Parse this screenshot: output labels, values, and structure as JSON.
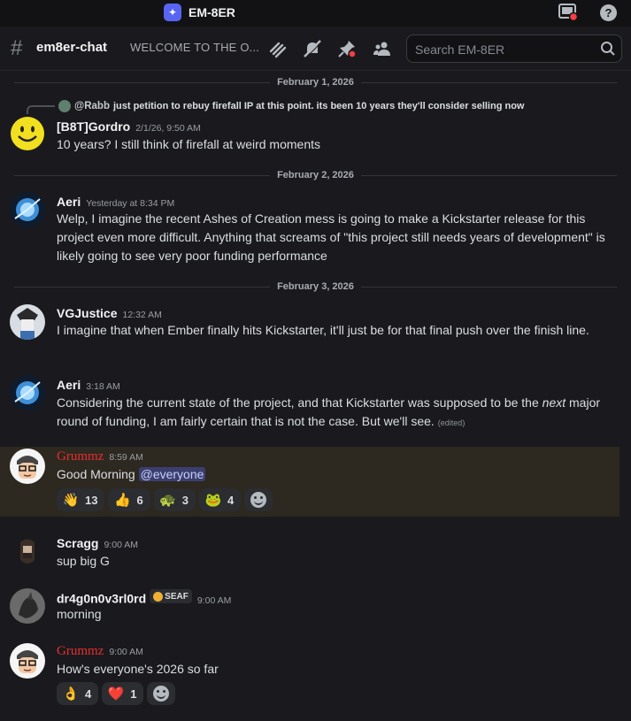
{
  "app": {
    "name": "EM-8ER",
    "icon": "discord-app-icon"
  },
  "channel": {
    "name": "em8er-chat",
    "topic": "WELCOME TO THE O..."
  },
  "search": {
    "placeholder": "Search EM-8ER"
  },
  "colors": {
    "background": "#1a1a1e",
    "username_red": "#e62e2e",
    "mention_bg": "#3b3f6e",
    "highlight": "#2d2820"
  },
  "dividers": [
    "February 1, 2026",
    "February 2, 2026",
    "February 3, 2026"
  ],
  "messages": [
    {
      "user": "[B8T]Gordro",
      "time": "2/1/26, 9:50 AM",
      "reply": {
        "user": "@Rabb",
        "text": "just petition to rebuy firefall IP at this point. its been 10 years they'll consider selling now"
      },
      "text": "10 years? I still think of firefall at weird moments"
    },
    {
      "user": "Aeri",
      "time": "Yesterday at 8:34 PM",
      "text": "Welp, I imagine the recent Ashes of Creation mess is going to make a Kickstarter release for this project even more difficult. Anything that screams of \"this project still needs years of development\"  is likely going to see very poor funding performance"
    },
    {
      "user": "VGJustice",
      "time": "12:32 AM",
      "text": "I imagine that when Ember finally hits Kickstarter, it'll just be for that final push over the finish line."
    },
    {
      "user": "Aeri",
      "time": "3:18 AM",
      "text_before": "Considering the current state of the project, and that Kickstarter was supposed to be the ",
      "text_italic": "next",
      "text_after": " major round of funding, I am fairly certain that is not the case. But we'll see.",
      "edited": "(edited)"
    },
    {
      "user": "Grummz",
      "time": "8:59 AM",
      "text": "Good Morning",
      "mention": "@everyone",
      "reactions": [
        {
          "emoji": "👋",
          "count": "13"
        },
        {
          "emoji": "👍",
          "count": "6"
        },
        {
          "emoji": "🐢",
          "count": "3"
        },
        {
          "emoji": "🐸",
          "count": "4"
        }
      ]
    },
    {
      "user": "Scragg",
      "time": "9:00 AM",
      "text": "sup big G"
    },
    {
      "user": "dr4g0n0v3rl0rd",
      "badge": "SEAF",
      "time": "9:00 AM",
      "text": "morning"
    },
    {
      "user": "Grummz",
      "time": "9:00 AM",
      "text": "How's everyone's 2026 so far",
      "reactions": [
        {
          "emoji": "👌",
          "count": "4"
        },
        {
          "emoji": "❤️",
          "count": "1"
        }
      ]
    }
  ]
}
